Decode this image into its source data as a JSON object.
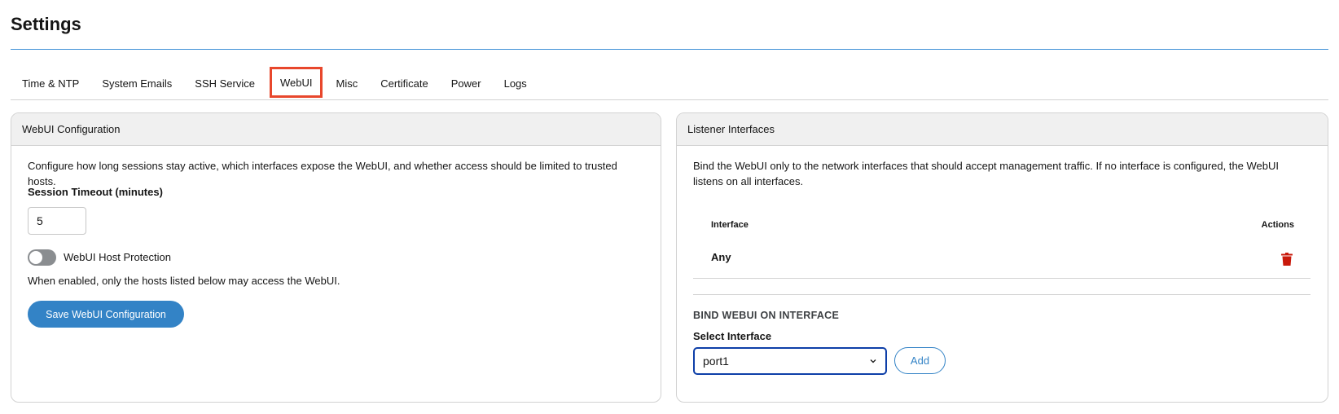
{
  "page": {
    "title": "Settings"
  },
  "tabs": [
    {
      "label": "Time & NTP"
    },
    {
      "label": "System Emails"
    },
    {
      "label": "SSH Service"
    },
    {
      "label": "WebUI",
      "active": true
    },
    {
      "label": "Misc"
    },
    {
      "label": "Certificate"
    },
    {
      "label": "Power"
    },
    {
      "label": "Logs"
    }
  ],
  "webui_config": {
    "header": "WebUI Configuration",
    "description": "Configure how long sessions stay active, which interfaces expose the WebUI, and whether access should be limited to trusted hosts.",
    "session_timeout_label": "Session Timeout (minutes)",
    "session_timeout_value": "5",
    "host_protection_label": "WebUI Host Protection",
    "host_protection_enabled": false,
    "host_protection_help": "When enabled, only the hosts listed below may access the WebUI.",
    "save_label": "Save WebUI Configuration"
  },
  "listener": {
    "header": "Listener Interfaces",
    "description": "Bind the WebUI only to the network interfaces that should accept management traffic. If no interface is configured, the WebUI listens on all interfaces.",
    "columns": {
      "interface": "Interface",
      "actions": "Actions"
    },
    "rows": [
      {
        "interface": "Any",
        "action_icon": "trash-icon"
      }
    ],
    "bind_title": "BIND WEBUI ON INTERFACE",
    "select_label": "Select Interface",
    "select_value": "port1",
    "add_label": "Add"
  },
  "colors": {
    "accent": "#3383c6",
    "active_tab_highlight": "#e8472c",
    "delete": "#c9190b",
    "select_focus": "#0e3fa8"
  }
}
